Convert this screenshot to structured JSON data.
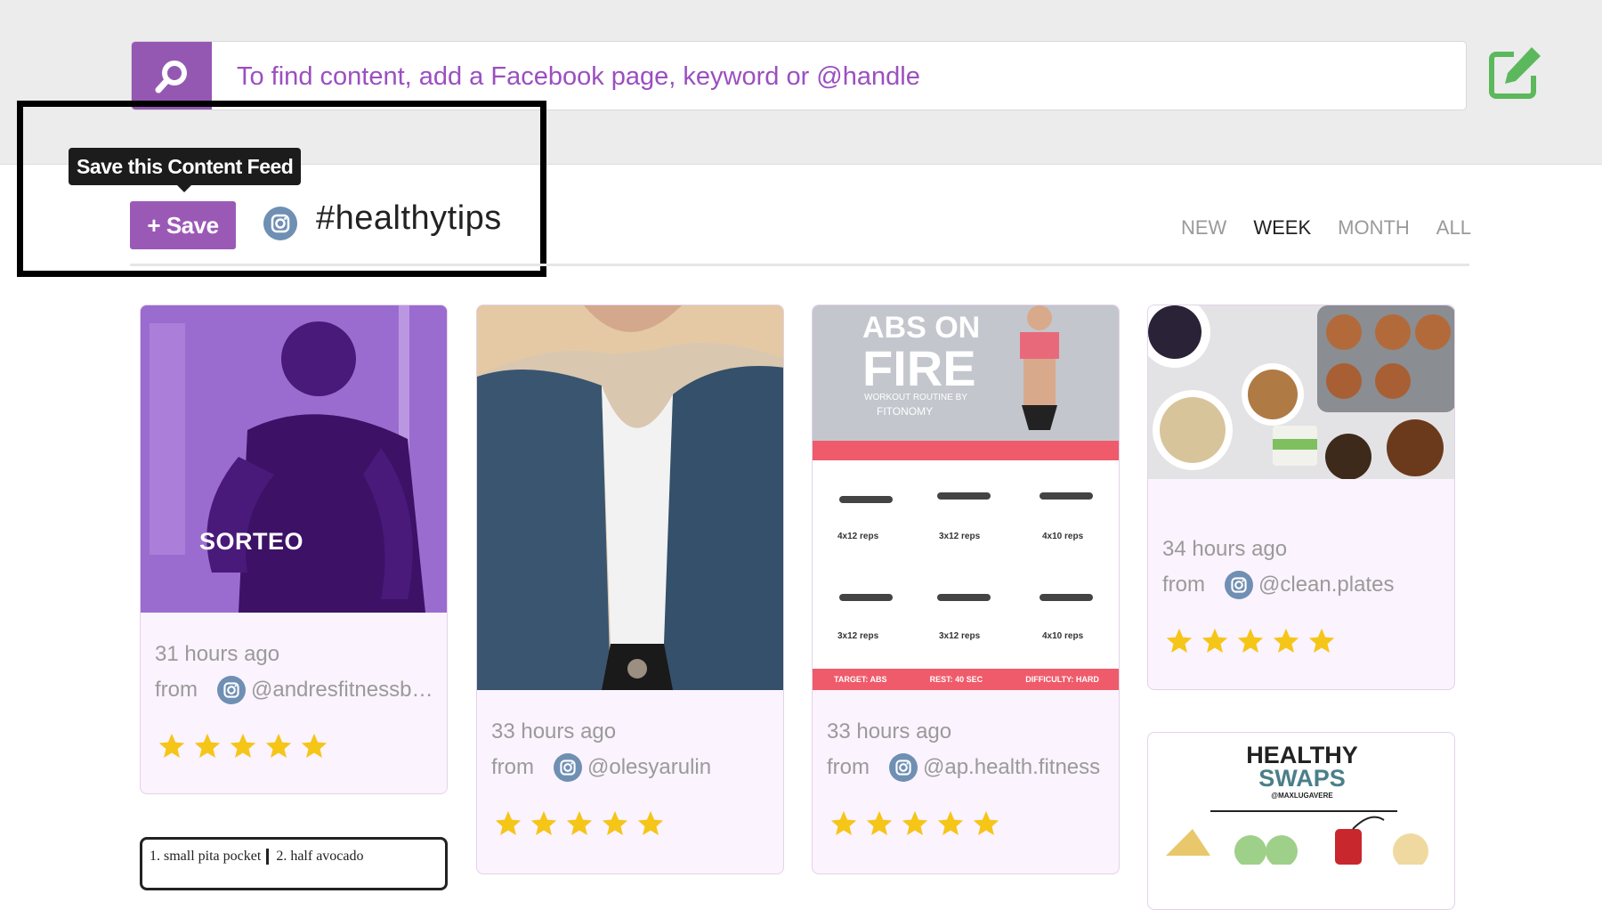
{
  "search": {
    "placeholder": "To find content, add a Facebook page, keyword or @handle"
  },
  "feed": {
    "tooltip": "Save this Content Feed",
    "save_label": "+ Save",
    "title": "#healthytips"
  },
  "tabs": [
    {
      "label": "NEW",
      "active": false
    },
    {
      "label": "WEEK",
      "active": true
    },
    {
      "label": "MONTH",
      "active": false
    },
    {
      "label": "ALL",
      "active": false
    }
  ],
  "cards": [
    {
      "time": "31 hours ago",
      "from": "from",
      "handle": "@andresfitnessbo...",
      "rating": 5,
      "image_text": "SORTEO"
    },
    {
      "time": "33 hours ago",
      "from": "from",
      "handle": "@olesyarulin",
      "rating": 5
    },
    {
      "time": "33 hours ago",
      "from": "from",
      "handle": "@ap.health.fitness",
      "rating": 5,
      "image_text": {
        "line1": "ABS ON",
        "line2": "FIRE",
        "line3": "WORKOUT ROUTINE BY",
        "line4": "FITONOMY",
        "reps": [
          "4x12 reps",
          "3x12 reps",
          "4x10 reps",
          "3x12 reps",
          "3x12 reps",
          "4x10 reps"
        ],
        "footer_target": "TARGET: ABS",
        "footer_rest": "REST: 40 SEC",
        "footer_difficulty": "DIFFICULTY: HARD"
      }
    },
    {
      "time": "34 hours ago",
      "from": "from",
      "handle": "@clean.plates",
      "rating": 5
    },
    {
      "image_text": {
        "line1": "HEALTHY",
        "line2": "SWAPS",
        "line3": "@MAXLUGAVERE"
      }
    },
    {
      "image_text": {
        "cell1": "1. small pita pocket",
        "cell2": "2. half avocado"
      }
    }
  ],
  "colors": {
    "brand_purple": "#9b59b6",
    "compose_green": "#5cb85c",
    "star": "#f5c518",
    "card_bg": "#fbf3fd"
  }
}
